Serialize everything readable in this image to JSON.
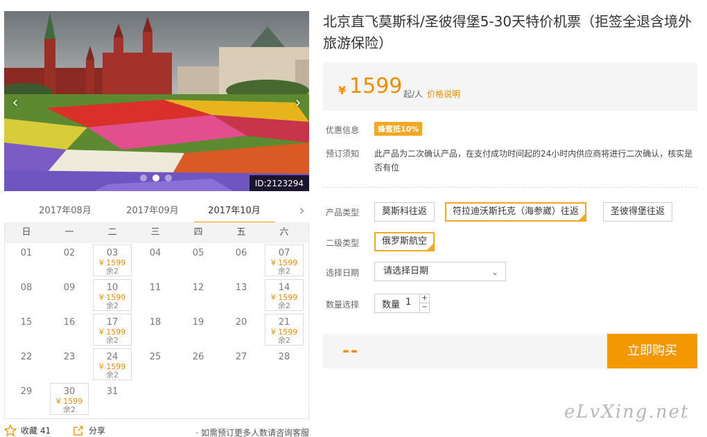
{
  "photo": {
    "id_label": "ID:2123294",
    "prev_icon": "chevron-left-icon",
    "next_icon": "chevron-right-icon",
    "slides_total": 3,
    "slide_active": 2
  },
  "calendar": {
    "months": [
      "2017年08月",
      "2017年09月",
      "2017年10月"
    ],
    "active_month": "2017年10月",
    "weekdays": [
      "日",
      "一",
      "二",
      "三",
      "四",
      "五",
      "六"
    ],
    "leading_blank_days": 0,
    "days": [
      {
        "d": "01"
      },
      {
        "d": "02"
      },
      {
        "d": "03",
        "price": "¥ 1599",
        "stock": "余2"
      },
      {
        "d": "04"
      },
      {
        "d": "05"
      },
      {
        "d": "06"
      },
      {
        "d": "07",
        "price": "¥ 1599",
        "stock": "余2"
      },
      {
        "d": "08"
      },
      {
        "d": "09"
      },
      {
        "d": "10",
        "price": "¥ 1599",
        "stock": "余2"
      },
      {
        "d": "11"
      },
      {
        "d": "12"
      },
      {
        "d": "13"
      },
      {
        "d": "14",
        "price": "¥ 1599",
        "stock": "余2"
      },
      {
        "d": "15"
      },
      {
        "d": "16"
      },
      {
        "d": "17",
        "price": "¥ 1599",
        "stock": "余2"
      },
      {
        "d": "18"
      },
      {
        "d": "19"
      },
      {
        "d": "20"
      },
      {
        "d": "21",
        "price": "¥ 1599",
        "stock": "余2"
      },
      {
        "d": "22"
      },
      {
        "d": "23"
      },
      {
        "d": "24",
        "price": "¥ 1599",
        "stock": "余2"
      },
      {
        "d": "25"
      },
      {
        "d": "26"
      },
      {
        "d": "27"
      },
      {
        "d": "28"
      },
      {
        "d": "29"
      },
      {
        "d": "30",
        "price": "¥ 1599",
        "stock": "余2"
      },
      {
        "d": "31"
      }
    ]
  },
  "actions": {
    "favorite_label": "收藏 41",
    "share_label": "分享",
    "consult_note": "· 如需预订更多人数请咨询客服"
  },
  "product": {
    "title": "北京直飞莫斯科/圣彼得堡5-30天特价机票（拒签全退含境外旅游保险）",
    "currency": "¥",
    "price": "1599",
    "price_unit": "起/人",
    "price_note": "价格说明",
    "discount_label": "优惠信息",
    "discount_tag": "蜂蜜抵10%",
    "notice_label": "预订须知",
    "notice_text": "此产品为二次确认产品，在支付成功时间起的24小时内供应商将进行二次确认，核实是否有位",
    "type_label": "产品类型",
    "types": [
      "莫斯科往返",
      "符拉迪沃斯托克（海参崴）往返",
      "圣彼得堡往返"
    ],
    "selected_type": "符拉迪沃斯托克（海参崴）往返",
    "subtype_label": "二级类型",
    "subtypes": [
      "俄罗斯航空"
    ],
    "date_label": "选择日期",
    "date_placeholder": "请选择日期",
    "qty_label": "数量选择",
    "qty_inner_label": "数量",
    "qty_value": "1",
    "total": "--",
    "buy_label": "立即购买"
  },
  "watermark": "eLvXing.net",
  "colors": {
    "accent": "#f39800",
    "price": "#f08c00",
    "tag": "#f5a623"
  }
}
